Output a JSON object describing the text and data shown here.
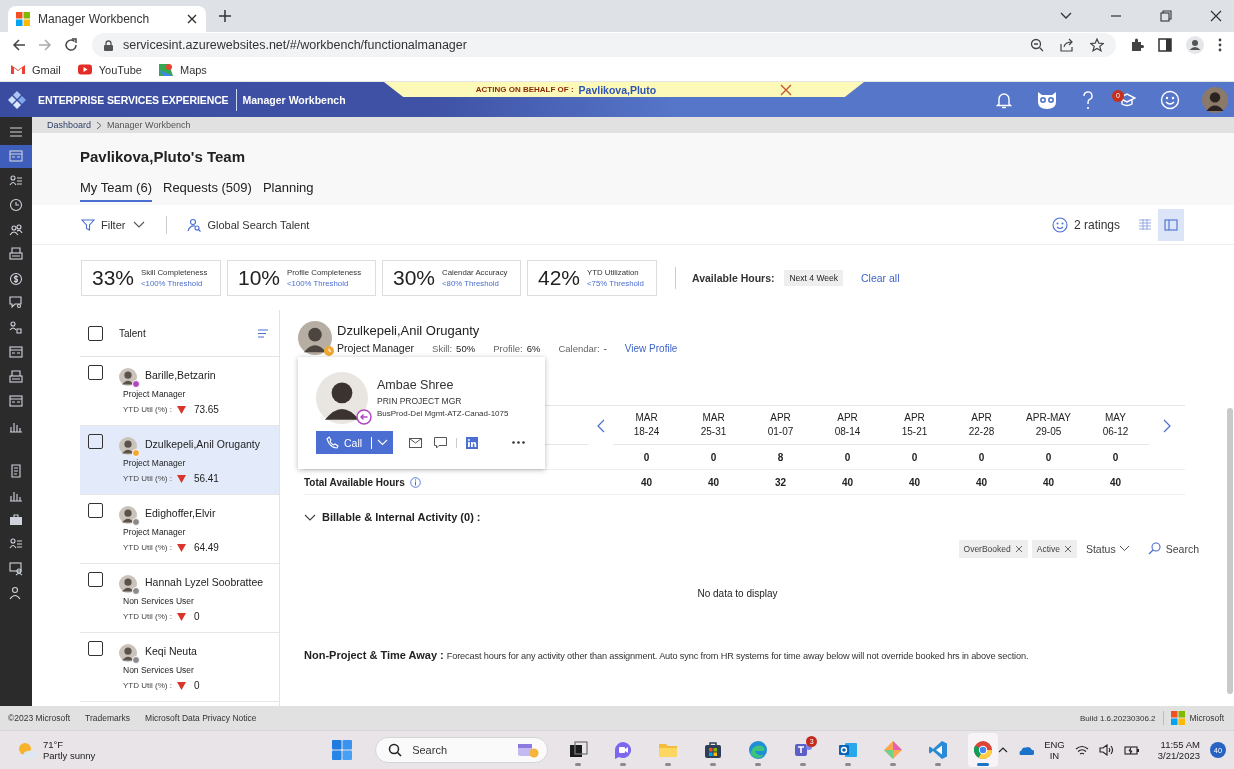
{
  "browser": {
    "tab_title": "Manager Workbench",
    "url": "servicesint.azurewebsites.net/#/workbench/functionalmanager",
    "bookmarks": [
      {
        "label": "Gmail",
        "kind": "gmail"
      },
      {
        "label": "YouTube",
        "kind": "youtube"
      },
      {
        "label": "Maps",
        "kind": "maps"
      }
    ]
  },
  "header": {
    "brand": "ENTERPRISE SERVICES EXPERIENCE",
    "app": "Manager Workbench",
    "banner_label": "ACTING ON BEHALF OF :",
    "banner_name": "Pavlikova,Pluto",
    "learning_badge": "0"
  },
  "breadcrumb": [
    "Dashboard",
    "Manager Workbench"
  ],
  "sidebar": {
    "items": [
      {
        "kind": "menu",
        "selected": false
      },
      {
        "kind": "card",
        "selected": true
      },
      {
        "kind": "list",
        "selected": false
      },
      {
        "kind": "clock",
        "selected": false
      },
      {
        "kind": "people",
        "selected": false
      },
      {
        "kind": "print",
        "selected": false
      },
      {
        "kind": "dollar",
        "selected": false
      },
      {
        "kind": "chat",
        "selected": false
      },
      {
        "kind": "flow",
        "selected": false
      },
      {
        "kind": "card",
        "selected": false
      },
      {
        "kind": "print",
        "selected": false
      },
      {
        "kind": "card",
        "selected": false
      },
      {
        "kind": "chart",
        "selected": false
      },
      {
        "kind": "doc",
        "selected": false
      },
      {
        "kind": "chart",
        "selected": false
      },
      {
        "kind": "briefcase",
        "selected": false
      },
      {
        "kind": "list",
        "selected": false
      },
      {
        "kind": "screen",
        "selected": false
      },
      {
        "kind": "person",
        "selected": false
      }
    ]
  },
  "page": {
    "title": "Pavlikova,Pluto's Team",
    "tabs": [
      {
        "label": "My Team (6)",
        "selected": true
      },
      {
        "label": "Requests (509)",
        "selected": false
      },
      {
        "label": "Planning",
        "selected": false
      }
    ]
  },
  "toolbar": {
    "filter": "Filter",
    "global_search": "Global Search Talent",
    "ratings": "2 ratings",
    "views": [
      {
        "kind": "grid",
        "selected": false
      },
      {
        "kind": "panel",
        "selected": true
      }
    ]
  },
  "metrics": [
    {
      "value": "33%",
      "label": "Skill Completeness",
      "threshold": "<100% Threshold"
    },
    {
      "value": "10%",
      "label": "Profile Completeness",
      "threshold": "<100% Threshold"
    },
    {
      "value": "30%",
      "label": "Calendar Accuracy",
      "threshold": "<80% Threshold"
    },
    {
      "value": "42%",
      "label": "YTD Utilization",
      "threshold": "<75% Threshold"
    }
  ],
  "available_hours": {
    "label": "Available Hours:",
    "chip": "Next 4 Week",
    "clear": "Clear all"
  },
  "talent_list": {
    "header": "Talent",
    "checked": false,
    "rows": [
      {
        "name": "Barille,Betzarin",
        "role": "Project Manager",
        "util_label": "YTD Util (%) :",
        "util": "73.65",
        "color": "#b146c2",
        "selected": false,
        "checked": false
      },
      {
        "name": "Dzulkepeli,Anil Oruganty",
        "role": "Project Manager",
        "util_label": "YTD Util (%) :",
        "util": "56.41",
        "color": "#f0a830",
        "selected": true,
        "checked": false
      },
      {
        "name": "Edighoffer,Elvir",
        "role": "Project Manager",
        "util_label": "YTD Util (%) :",
        "util": "64.49",
        "color": "#8a8a8a",
        "selected": false,
        "checked": false
      },
      {
        "name": "Hannah Lyzel Soobrattee",
        "role": "Non Services User",
        "util_label": "YTD Util (%) :",
        "util": "0",
        "color": "#8a8a8a",
        "selected": false,
        "checked": false
      },
      {
        "name": "Keqi Neuta",
        "role": "Non Services User",
        "util_label": "YTD Util (%) :",
        "util": "0",
        "color": "#8a8a8a",
        "selected": false,
        "checked": false
      }
    ]
  },
  "detail": {
    "name": "Dzulkepeli,Anil Oruganty",
    "role": "Project Manager",
    "stats": [
      {
        "label": "Skill:",
        "value": "50%"
      },
      {
        "label": "Profile:",
        "value": "6%"
      },
      {
        "label": "Calendar:",
        "value": "-"
      }
    ],
    "view_profile": "View Profile",
    "weeks": [
      {
        "month": "MAR",
        "days": "18-24"
      },
      {
        "month": "MAR",
        "days": "25-31"
      },
      {
        "month": "APR",
        "days": "01-07"
      },
      {
        "month": "APR",
        "days": "08-14"
      },
      {
        "month": "APR",
        "days": "15-21"
      },
      {
        "month": "APR",
        "days": "22-28"
      },
      {
        "month": "APR-MAY",
        "days": "29-05"
      },
      {
        "month": "MAY",
        "days": "06-12"
      }
    ],
    "rows": [
      {
        "values": [
          "0",
          "0",
          "8",
          "0",
          "0",
          "0",
          "0",
          "0"
        ]
      },
      {
        "label": "Total Available Hours",
        "info": true,
        "values": [
          "40",
          "40",
          "32",
          "40",
          "40",
          "40",
          "40",
          "40"
        ]
      }
    ],
    "activity": {
      "title": "Billable & Internal Activity (0) :",
      "expanded": true,
      "chips": [
        "OverBooked",
        "Active"
      ],
      "status": "Status",
      "search": "Search",
      "empty": "No data to display"
    },
    "non_project": {
      "title": "Non-Project & Time Away :",
      "text": "Forecast hours for any activity other than assignment. Auto sync from HR systems for time away below will not override booked hrs in above section."
    }
  },
  "contact_card": {
    "name": "Ambae Shree",
    "title": "PRIN PROJECT MGR",
    "org": "BusProd-Del Mgmt-ATZ-Canad-1075",
    "call": "Call"
  },
  "footer": {
    "links": [
      "©2023 Microsoft",
      "Trademarks",
      "Microsoft Data Privacy Notice"
    ],
    "build": "Build 1.6.20230306.2",
    "brand": "Microsoft"
  },
  "taskbar": {
    "temp": "71°F",
    "weather": "Partly sunny",
    "search": "Search",
    "apps": [
      {
        "kind": "taskview",
        "active": false
      },
      {
        "kind": "meet",
        "active": false
      },
      {
        "kind": "folder",
        "active": false
      },
      {
        "kind": "store",
        "active": false
      },
      {
        "kind": "edge",
        "active": false
      },
      {
        "kind": "teams",
        "active": false,
        "badge": "3"
      },
      {
        "kind": "outlook",
        "active": false
      },
      {
        "kind": "diamond",
        "active": false
      },
      {
        "kind": "vscode",
        "active": false
      },
      {
        "kind": "chrome",
        "active": true
      }
    ],
    "lang": "ENG",
    "region": "IN",
    "time": "11:55 AM",
    "date": "3/21/2023",
    "notifications": "40"
  }
}
